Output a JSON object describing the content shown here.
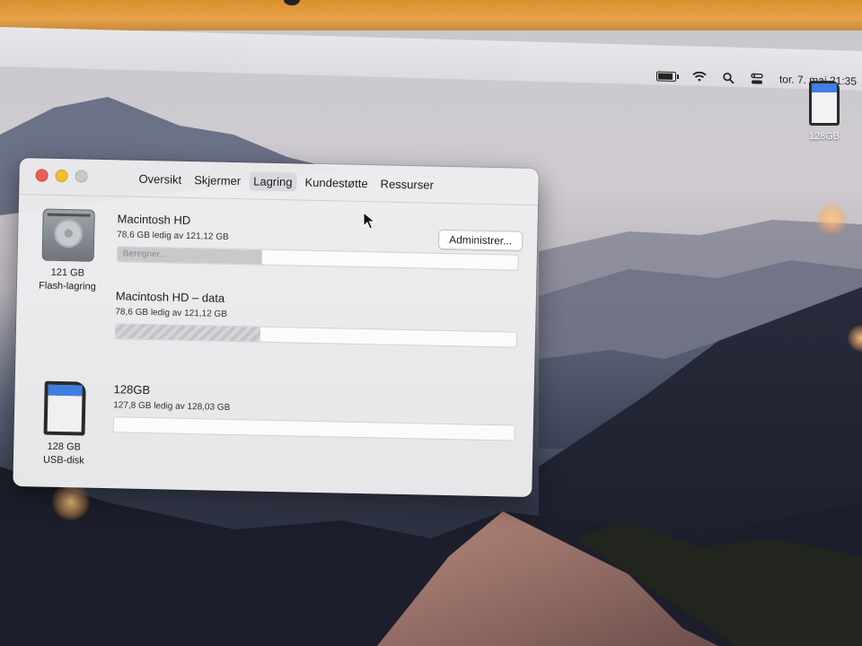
{
  "menubar": {
    "icons": [
      "battery-icon",
      "wifi-icon",
      "spotlight-search-icon",
      "control-center-icon"
    ],
    "clock": "tor. 7. mai  21:35"
  },
  "desktop": {
    "drive_icon": "sd-card-icon",
    "drive_label": "128GB"
  },
  "window": {
    "tabs": [
      {
        "label": "Oversikt",
        "active": false
      },
      {
        "label": "Skjermer",
        "active": false
      },
      {
        "label": "Lagring",
        "active": true
      },
      {
        "label": "Kundestøtte",
        "active": false
      },
      {
        "label": "Ressurser",
        "active": false
      }
    ],
    "manage_button": "Administrer...",
    "internal_disk": {
      "icon": "hard-drive-icon",
      "capacity": "121 GB",
      "type": "Flash-lagring",
      "volumes": [
        {
          "name": "Macintosh HD",
          "free": "78,6 GB ledig av 121,12 GB",
          "bar_label": "Beregner...",
          "used_fraction": 0.36
        },
        {
          "name": "Macintosh HD – data",
          "free": "78,6 GB ledig av 121,12 GB",
          "bar_label": "",
          "used_fraction": 0.36
        }
      ]
    },
    "external_disk": {
      "icon": "sd-card-icon",
      "capacity": "128 GB",
      "type": "USB-disk",
      "volume": {
        "name": "128GB",
        "free": "127,8 GB ledig av 128,03 GB",
        "used_fraction": 0.0
      }
    }
  }
}
